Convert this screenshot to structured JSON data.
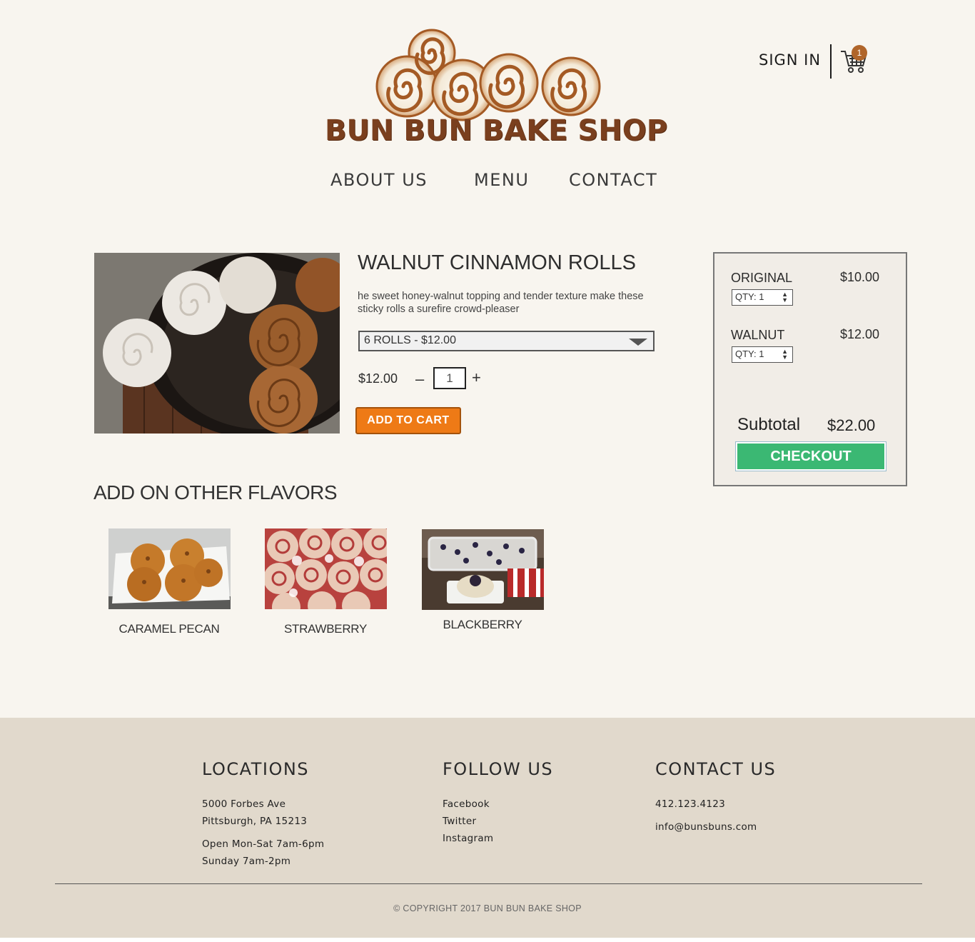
{
  "brand": {
    "name": "BUN BUN BAKE SHOP",
    "text_color": "#7a3f1e"
  },
  "header": {
    "signin_label": "SIGN IN",
    "cart_count": "1",
    "nav": [
      "ABOUT US",
      "MENU",
      "CONTACT"
    ]
  },
  "product": {
    "title": "WALNUT CINNAMON ROLLS",
    "description": " he sweet honey-walnut topping and tender texture make these sticky rolls a surefire crowd-pleaser",
    "selected_option": "6 ROLLS - $12.00",
    "price": "$12.00",
    "minus": "–",
    "quantity": "1",
    "plus": "+",
    "add_to_cart_label": "ADD TO CART",
    "add_to_cart_color": "#ee7a16"
  },
  "addons": {
    "heading": "ADD ON OTHER FLAVORS",
    "items": [
      {
        "label": "CARAMEL PECAN"
      },
      {
        "label": "STRAWBERRY"
      },
      {
        "label": "BLACKBERRY"
      }
    ]
  },
  "cart_panel": {
    "items": [
      {
        "name": "ORIGINAL",
        "price": "$10.00",
        "qty_label": "QTY:  1"
      },
      {
        "name": "WALNUT",
        "price": "$12.00",
        "qty_label": "QTY:  1"
      }
    ],
    "subtotal_label": "Subtotal",
    "subtotal_value": "$22.00",
    "checkout_label": "CHECKOUT",
    "checkout_color": "#3bb873"
  },
  "footer": {
    "locations": {
      "heading": "LOCATIONS",
      "lines": [
        "5000 Forbes Ave",
        "Pittsburgh, PA 15213",
        "Open Mon-Sat 7am-6pm",
        "Sunday 7am-2pm"
      ]
    },
    "follow": {
      "heading": "FOLLOW US",
      "links": [
        "Facebook",
        "Twitter",
        "Instagram"
      ]
    },
    "contact": {
      "heading": "CONTACT US",
      "phone": "412.123.4123",
      "email": "info@bunsbuns.com"
    },
    "copyright": "© COPYRIGHT 2017 BUN BUN BAKE SHOP"
  }
}
